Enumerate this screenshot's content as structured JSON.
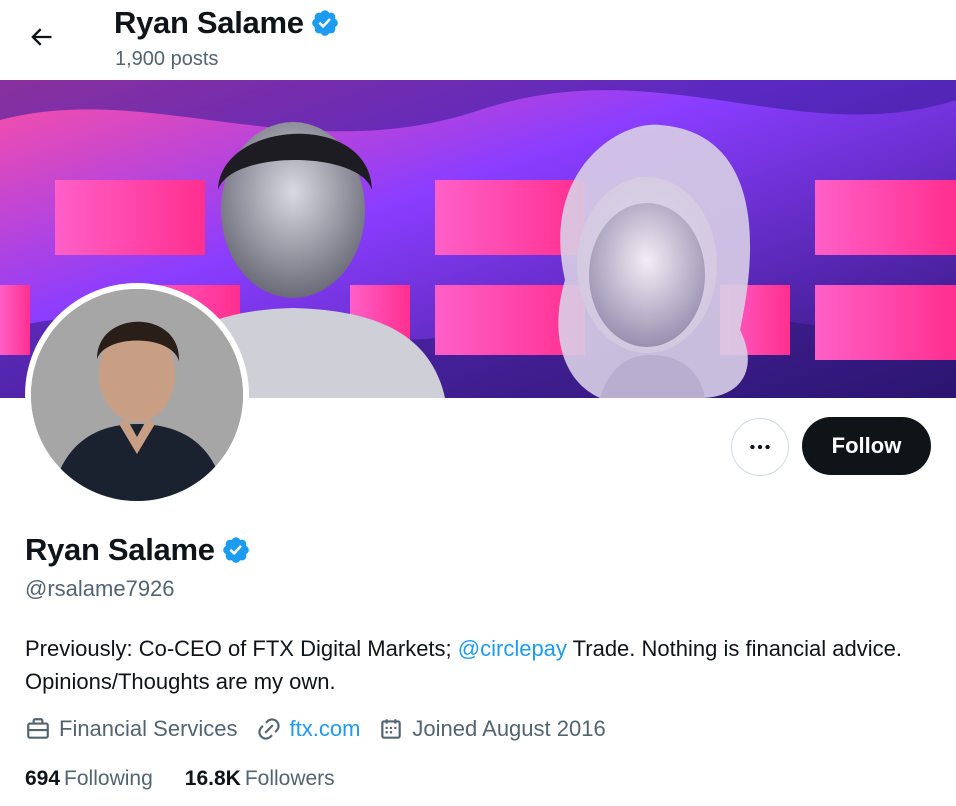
{
  "header": {
    "name": "Ryan Salame",
    "posts_count": "1,900 posts"
  },
  "profile": {
    "display_name": "Ryan Salame",
    "handle": "@rsalame7926",
    "bio_prefix": "Previously: Co-CEO of FTX Digital Markets; ",
    "bio_mention": "@circlepay",
    "bio_suffix": " Trade. Nothing is financial advice. Opinions/Thoughts are my own.",
    "category": "Financial Services",
    "website": "ftx.com",
    "joined": "Joined August 2016",
    "following_count": "694",
    "following_label": "Following",
    "followers_count": "16.8K",
    "followers_label": "Followers"
  },
  "actions": {
    "follow_label": "Follow"
  },
  "icons": {
    "back": "arrow-left-icon",
    "verified": "verified-badge-icon",
    "more": "more-dots-icon",
    "category": "briefcase-icon",
    "website": "link-icon",
    "joined": "calendar-icon"
  },
  "colors": {
    "accent": "#1d9bf0",
    "text_primary": "#0f1419",
    "text_secondary": "#536471",
    "follow_button": "#0f1419"
  }
}
